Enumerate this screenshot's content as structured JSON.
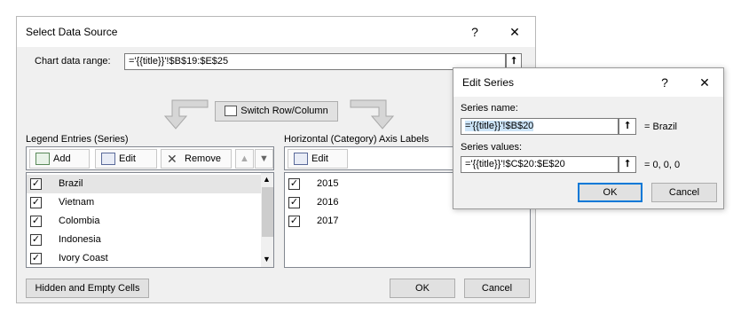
{
  "main_dialog": {
    "title": "Select Data Source",
    "help_glyph": "?",
    "close_glyph": "✕",
    "chart_range_label": "Chart data range:",
    "chart_range_value": "='{{title}}'!$B$19:$E$25",
    "switch_button": "Switch Row/Column",
    "legend_label": "Legend Entries (Series)",
    "axis_label": "Horizontal (Category) Axis Labels",
    "add_button": "Add",
    "edit_button": "Edit",
    "remove_button": "Remove",
    "axis_edit_button": "Edit",
    "series": [
      {
        "label": "Brazil",
        "checked": true
      },
      {
        "label": "Vietnam",
        "checked": true
      },
      {
        "label": "Colombia",
        "checked": true
      },
      {
        "label": "Indonesia",
        "checked": true
      },
      {
        "label": "Ivory Coast",
        "checked": true
      }
    ],
    "categories": [
      {
        "label": "2015",
        "checked": true
      },
      {
        "label": "2016",
        "checked": true
      },
      {
        "label": "2017",
        "checked": true
      }
    ],
    "hidden_cells_button": "Hidden and Empty Cells",
    "ok_button": "OK",
    "cancel_button": "Cancel",
    "check_glyph": "✓"
  },
  "edit_series": {
    "title": "Edit Series",
    "help_glyph": "?",
    "close_glyph": "✕",
    "name_label": "Series name:",
    "name_value": "='{{title}}'!$B$20",
    "name_result": "= Brazil",
    "values_label": "Series values:",
    "values_value": "='{{title}}'!$C$20:$E$20",
    "values_result": "= 0, 0, 0",
    "ok_button": "OK",
    "cancel_button": "Cancel",
    "collapse_glyph": "⭡"
  },
  "colors": {
    "accent": "#0078d7",
    "dialog_bg": "#f0f0f0",
    "selection": "#cce4f7"
  }
}
